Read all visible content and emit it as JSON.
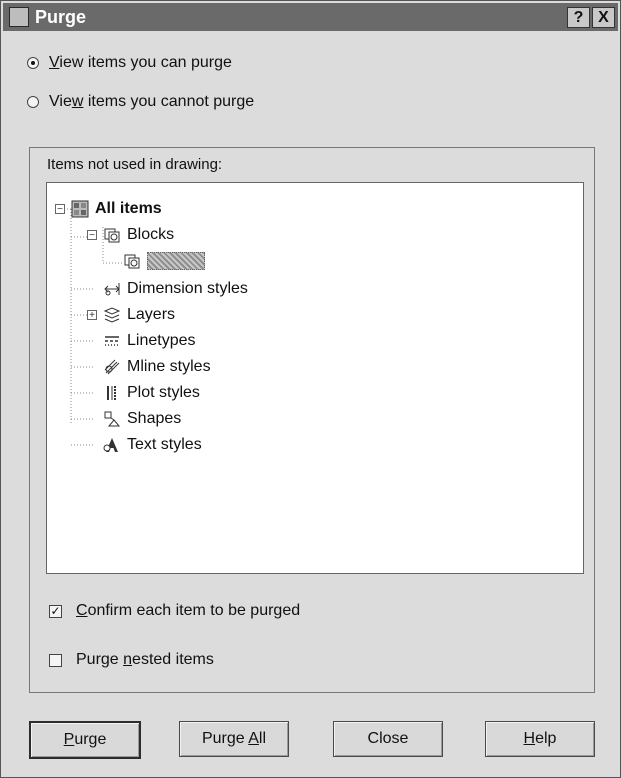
{
  "window": {
    "title": "Purge",
    "help_glyph": "?",
    "close_glyph": "X"
  },
  "radios": [
    {
      "label_before": "",
      "mnemonic": "V",
      "label_after": "iew items you can purge",
      "checked": true
    },
    {
      "label_before": "Vie",
      "mnemonic": "w",
      "label_after": " items you cannot purge",
      "checked": false
    }
  ],
  "group": {
    "label": "Items not used in drawing:"
  },
  "tree": {
    "items": [
      {
        "label": "All items",
        "level": 0,
        "expander": "−",
        "bold": true,
        "icon": "all-items-icon"
      },
      {
        "label": "Blocks",
        "level": 1,
        "expander": "−",
        "bold": false,
        "icon": "blocks-icon"
      },
      {
        "label": "",
        "level": 2,
        "expander": "",
        "bold": false,
        "icon": "block-icon",
        "selected": true
      },
      {
        "label": "Dimension styles",
        "level": 1,
        "expander": "",
        "bold": false,
        "icon": "dimension-styles-icon"
      },
      {
        "label": "Layers",
        "level": 1,
        "expander": "+",
        "bold": false,
        "icon": "layers-icon"
      },
      {
        "label": "Linetypes",
        "level": 1,
        "expander": "",
        "bold": false,
        "icon": "linetypes-icon"
      },
      {
        "label": "Mline styles",
        "level": 1,
        "expander": "",
        "bold": false,
        "icon": "mline-styles-icon"
      },
      {
        "label": "Plot styles",
        "level": 1,
        "expander": "",
        "bold": false,
        "icon": "plot-styles-icon"
      },
      {
        "label": "Shapes",
        "level": 1,
        "expander": "",
        "bold": false,
        "icon": "shapes-icon"
      },
      {
        "label": "Text styles",
        "level": 1,
        "expander": "",
        "bold": false,
        "icon": "text-styles-icon"
      }
    ]
  },
  "checkboxes": {
    "confirm": {
      "mnemonic": "C",
      "label_after": "onfirm each item to be purged",
      "checked": true,
      "check_glyph": "✓"
    },
    "nested": {
      "label_before": "Purge ",
      "mnemonic": "n",
      "label_after": "ested items",
      "checked": false
    }
  },
  "buttons": {
    "purge": {
      "mnemonic": "P",
      "label_after": "urge"
    },
    "purge_all": {
      "label_before": "Purge ",
      "mnemonic": "A",
      "label_after": "ll"
    },
    "close": {
      "label": "Close"
    },
    "help": {
      "mnemonic": "H",
      "label_after": "elp"
    }
  },
  "colors": {
    "title_bar": "#6a6a6a",
    "dialog_bg": "#dcdcdc",
    "tree_bg": "#ffffff"
  }
}
